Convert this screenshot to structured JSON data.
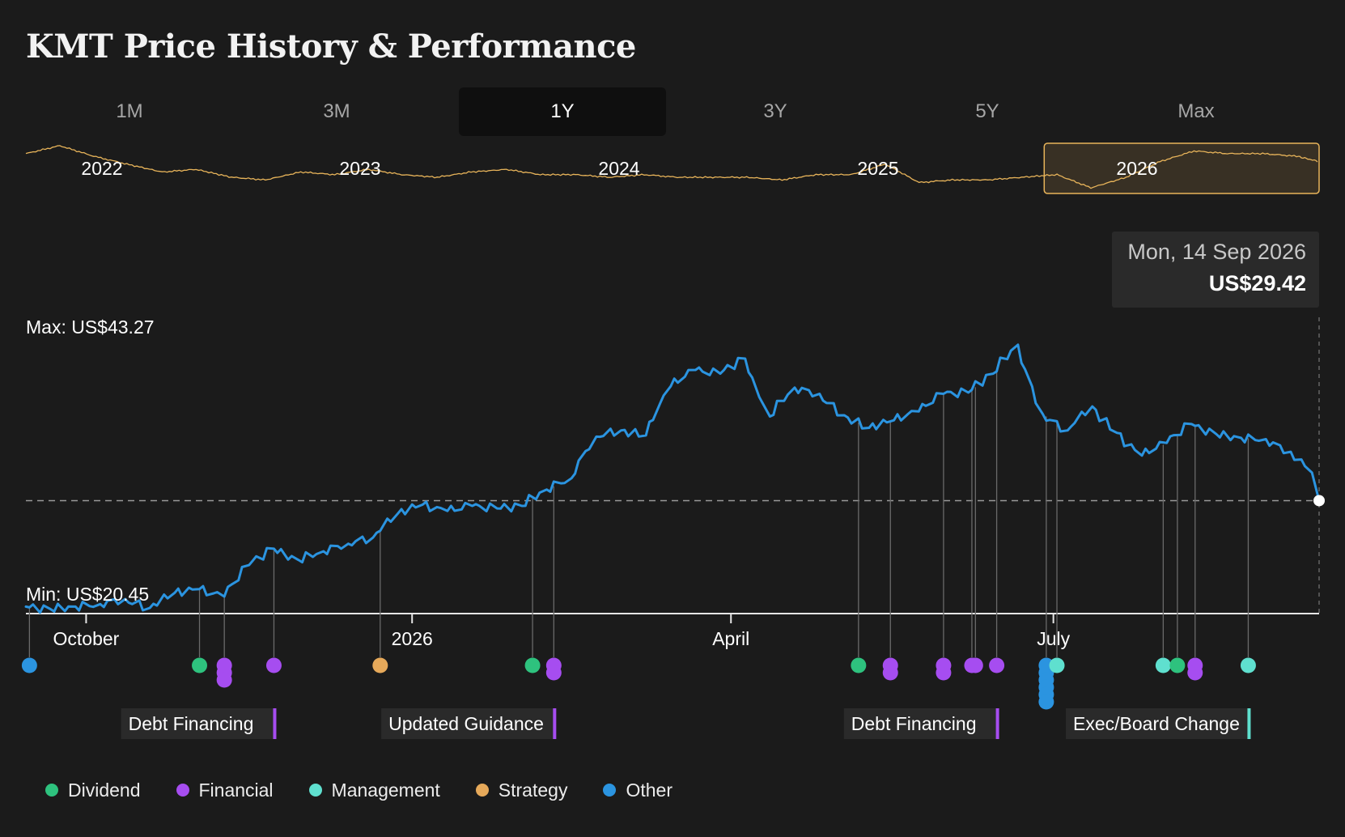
{
  "title": "KMT Price History & Performance",
  "tabs": [
    "1M",
    "3M",
    "1Y",
    "3Y",
    "5Y",
    "Max"
  ],
  "active_tab": "1Y",
  "tooltip": {
    "date": "Mon, 14 Sep 2026",
    "price": "US$29.42"
  },
  "colors": {
    "price_line": "#2b94e0",
    "mini_line": "#e8b45a",
    "dividend": "#2ec27e",
    "financial": "#a64df0",
    "management": "#5fe0cf",
    "strategy": "#e6a95a",
    "other": "#2b94e0"
  },
  "legend": [
    {
      "label": "Dividend",
      "color": "#2ec27e"
    },
    {
      "label": "Financial",
      "color": "#a64df0"
    },
    {
      "label": "Management",
      "color": "#5fe0cf"
    },
    {
      "label": "Strategy",
      "color": "#e6a95a"
    },
    {
      "label": "Other",
      "color": "#2b94e0"
    }
  ],
  "chart_data": [
    {
      "type": "line",
      "name": "overview",
      "x_labels": [
        "2022",
        "2023",
        "2024",
        "2025",
        "2026"
      ],
      "x_range": [
        "2022-01-01",
        "2026-09-14"
      ],
      "selected_range": [
        "2025-09-14",
        "2026-09-14"
      ],
      "x": [
        "2022-01-01",
        "2022-02-15",
        "2022-04-01",
        "2022-05-15",
        "2022-07-01",
        "2022-08-15",
        "2022-10-01",
        "2022-11-15",
        "2023-01-01",
        "2023-02-15",
        "2023-04-01",
        "2023-05-15",
        "2023-07-01",
        "2023-08-15",
        "2023-10-01",
        "2023-11-15",
        "2024-01-01",
        "2024-02-15",
        "2024-04-01",
        "2024-05-15",
        "2024-07-01",
        "2024-08-15",
        "2024-10-01",
        "2024-11-15",
        "2025-01-01",
        "2025-02-15",
        "2025-04-01",
        "2025-05-15",
        "2025-07-01",
        "2025-08-15",
        "2025-10-01",
        "2025-11-15",
        "2026-01-01",
        "2026-02-15",
        "2026-04-01",
        "2026-05-15",
        "2026-07-01",
        "2026-08-15",
        "2026-09-14"
      ],
      "y": [
        35,
        38,
        34,
        31,
        28,
        29,
        26,
        25,
        28,
        27,
        29,
        27,
        26,
        28,
        29,
        27,
        27,
        26,
        27,
        26,
        26,
        26,
        25,
        27,
        27,
        31,
        24,
        25,
        25,
        26,
        27,
        22,
        26,
        32,
        36,
        35,
        35,
        34,
        32
      ]
    },
    {
      "type": "line",
      "name": "KMT",
      "y_range": [
        20.45,
        43.27
      ],
      "y_max_label": "Max: US$43.27",
      "y_min_label": "Min: US$20.45",
      "reference_value": 29.42,
      "x_ticks": [
        {
          "label": "October",
          "date": "2025-10-01"
        },
        {
          "label": "2026",
          "date": "2026-01-01"
        },
        {
          "label": "April",
          "date": "2026-04-01"
        },
        {
          "label": "July",
          "date": "2026-07-01"
        }
      ],
      "x_range": [
        "2025-09-14",
        "2026-09-14"
      ],
      "x": [
        "2025-09-14",
        "2025-09-21",
        "2025-09-28",
        "2025-10-05",
        "2025-10-12",
        "2025-10-19",
        "2025-10-26",
        "2025-11-02",
        "2025-11-09",
        "2025-11-16",
        "2025-11-23",
        "2025-11-30",
        "2025-12-07",
        "2025-12-14",
        "2025-12-21",
        "2025-12-28",
        "2026-01-04",
        "2026-01-11",
        "2026-01-18",
        "2026-01-25",
        "2026-02-01",
        "2026-02-08",
        "2026-02-15",
        "2026-02-22",
        "2026-03-01",
        "2026-03-08",
        "2026-03-15",
        "2026-03-22",
        "2026-03-29",
        "2026-04-05",
        "2026-04-12",
        "2026-04-19",
        "2026-04-26",
        "2026-05-03",
        "2026-05-10",
        "2026-05-17",
        "2026-05-24",
        "2026-05-31",
        "2026-06-07",
        "2026-06-14",
        "2026-06-21",
        "2026-06-28",
        "2026-07-05",
        "2026-07-12",
        "2026-07-19",
        "2026-07-26",
        "2026-08-02",
        "2026-08-09",
        "2026-08-16",
        "2026-08-23",
        "2026-08-30",
        "2026-09-06",
        "2026-09-14"
      ],
      "y": [
        21.0,
        20.8,
        21.0,
        21.2,
        21.6,
        20.9,
        22.1,
        22.4,
        21.8,
        24.3,
        25.6,
        24.7,
        25.4,
        26.0,
        26.5,
        28.4,
        29.1,
        28.6,
        29.0,
        28.8,
        29.0,
        30.3,
        31.2,
        34.5,
        35.0,
        34.6,
        38.5,
        39.8,
        39.5,
        40.7,
        36.1,
        38.4,
        37.9,
        36.2,
        35.2,
        35.8,
        36.5,
        37.9,
        38.0,
        39.5,
        41.8,
        36.3,
        35.0,
        36.9,
        34.8,
        33.0,
        34.0,
        35.5,
        34.7,
        34.4,
        34.3,
        33.3,
        31.4,
        31.3,
        31.8,
        31.0,
        31.1,
        35.0,
        32.3,
        32.0,
        35.1,
        32.5,
        31.5,
        33.2,
        32.7,
        34.3,
        32.0,
        33.1,
        34.2,
        32.6,
        34.5,
        31.1,
        31.3,
        29.8,
        29.4,
        29.6,
        29.8,
        29.4,
        29.6,
        30.2,
        29.0,
        29.42
      ]
    },
    {
      "type": "scatter",
      "name": "events",
      "events": [
        {
          "date": "2025-09-15",
          "category": "Other",
          "stack": 1
        },
        {
          "date": "2025-11-02",
          "category": "Dividend",
          "stack": 1
        },
        {
          "date": "2025-11-09",
          "category": "Financial",
          "stack": 3
        },
        {
          "date": "2025-11-23",
          "category": "Financial",
          "stack": 1,
          "label": "Debt Financing"
        },
        {
          "date": "2025-12-23",
          "category": "Strategy",
          "stack": 1
        },
        {
          "date": "2026-02-04",
          "category": "Dividend",
          "stack": 1
        },
        {
          "date": "2026-02-10",
          "category": "Financial",
          "stack": 2,
          "label": "Updated Guidance"
        },
        {
          "date": "2026-05-07",
          "category": "Dividend",
          "stack": 1
        },
        {
          "date": "2026-05-16",
          "category": "Financial",
          "stack": 2
        },
        {
          "date": "2026-05-31",
          "category": "Financial",
          "stack": 2
        },
        {
          "date": "2026-06-08",
          "category": "Financial",
          "stack": 1
        },
        {
          "date": "2026-06-09",
          "category": "Financial",
          "stack": 1
        },
        {
          "date": "2026-06-15",
          "category": "Financial",
          "stack": 1,
          "label": "Debt Financing"
        },
        {
          "date": "2026-06-29",
          "category": "Other",
          "stack": 6
        },
        {
          "date": "2026-07-02",
          "category": "Management",
          "stack": 1
        },
        {
          "date": "2026-08-01",
          "category": "Management",
          "stack": 1
        },
        {
          "date": "2026-08-05",
          "category": "Dividend",
          "stack": 1
        },
        {
          "date": "2026-08-10",
          "category": "Financial",
          "stack": 2
        },
        {
          "date": "2026-08-25",
          "category": "Management",
          "stack": 1,
          "label": "Exec/Board Change"
        }
      ]
    }
  ]
}
